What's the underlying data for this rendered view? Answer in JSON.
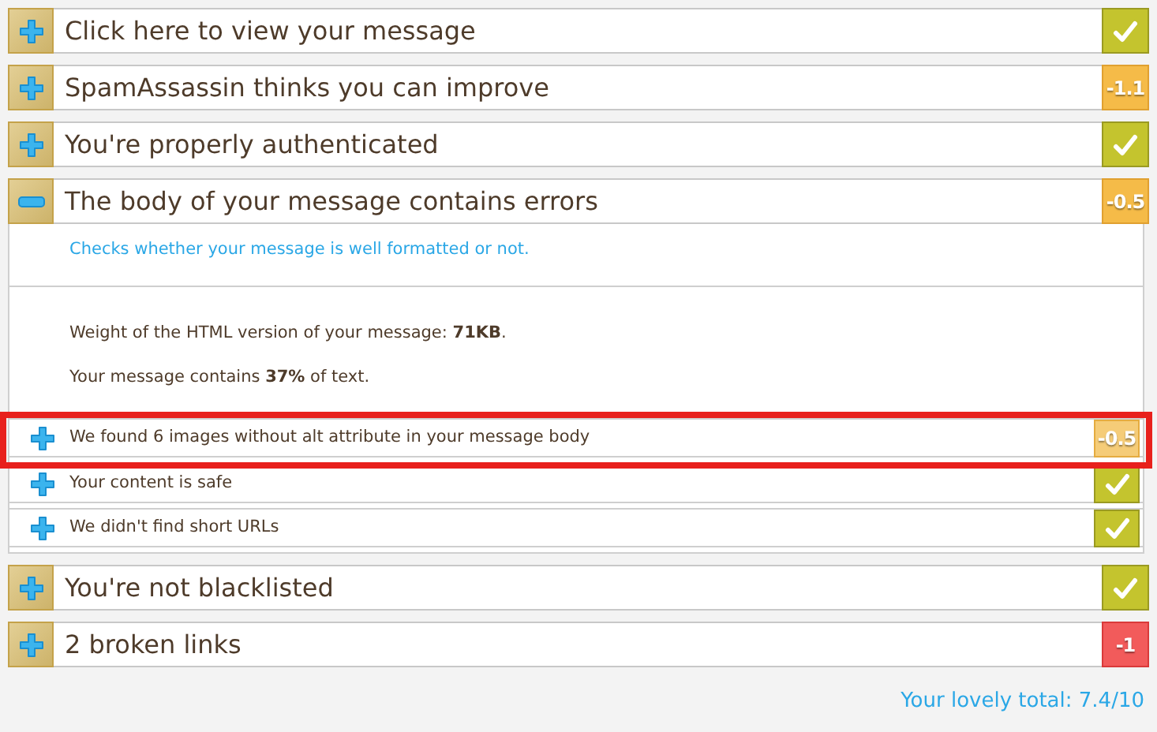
{
  "sections": [
    {
      "title": "Click here to view your message",
      "expanded": false,
      "kind": "pass"
    },
    {
      "title": "SpamAssassin thinks you can improve",
      "expanded": false,
      "kind": "warn",
      "score": "-1.1"
    },
    {
      "title": "You're properly authenticated",
      "expanded": false,
      "kind": "pass"
    },
    {
      "title": "The body of your message contains errors",
      "expanded": true,
      "kind": "warn",
      "score": "-0.5",
      "description": "Checks whether your message is well formatted or not.",
      "details": [
        "Weight of the HTML version of your message: **71KB**.",
        "Your message contains **37%** of text."
      ],
      "items": [
        {
          "label": "We found 6 images without alt attribute in your message body",
          "kind": "warn",
          "score": "-0.5",
          "highlighted": true
        },
        {
          "label": "Your content is safe",
          "kind": "pass",
          "highlighted": false
        },
        {
          "label": "We didn't find short URLs",
          "kind": "pass",
          "highlighted": false
        }
      ]
    },
    {
      "title": "You're not blacklisted",
      "expanded": false,
      "kind": "pass"
    },
    {
      "title": "2 broken links",
      "expanded": false,
      "kind": "fail",
      "score": "-1"
    }
  ],
  "total": "Your lovely total: 7.4/10"
}
